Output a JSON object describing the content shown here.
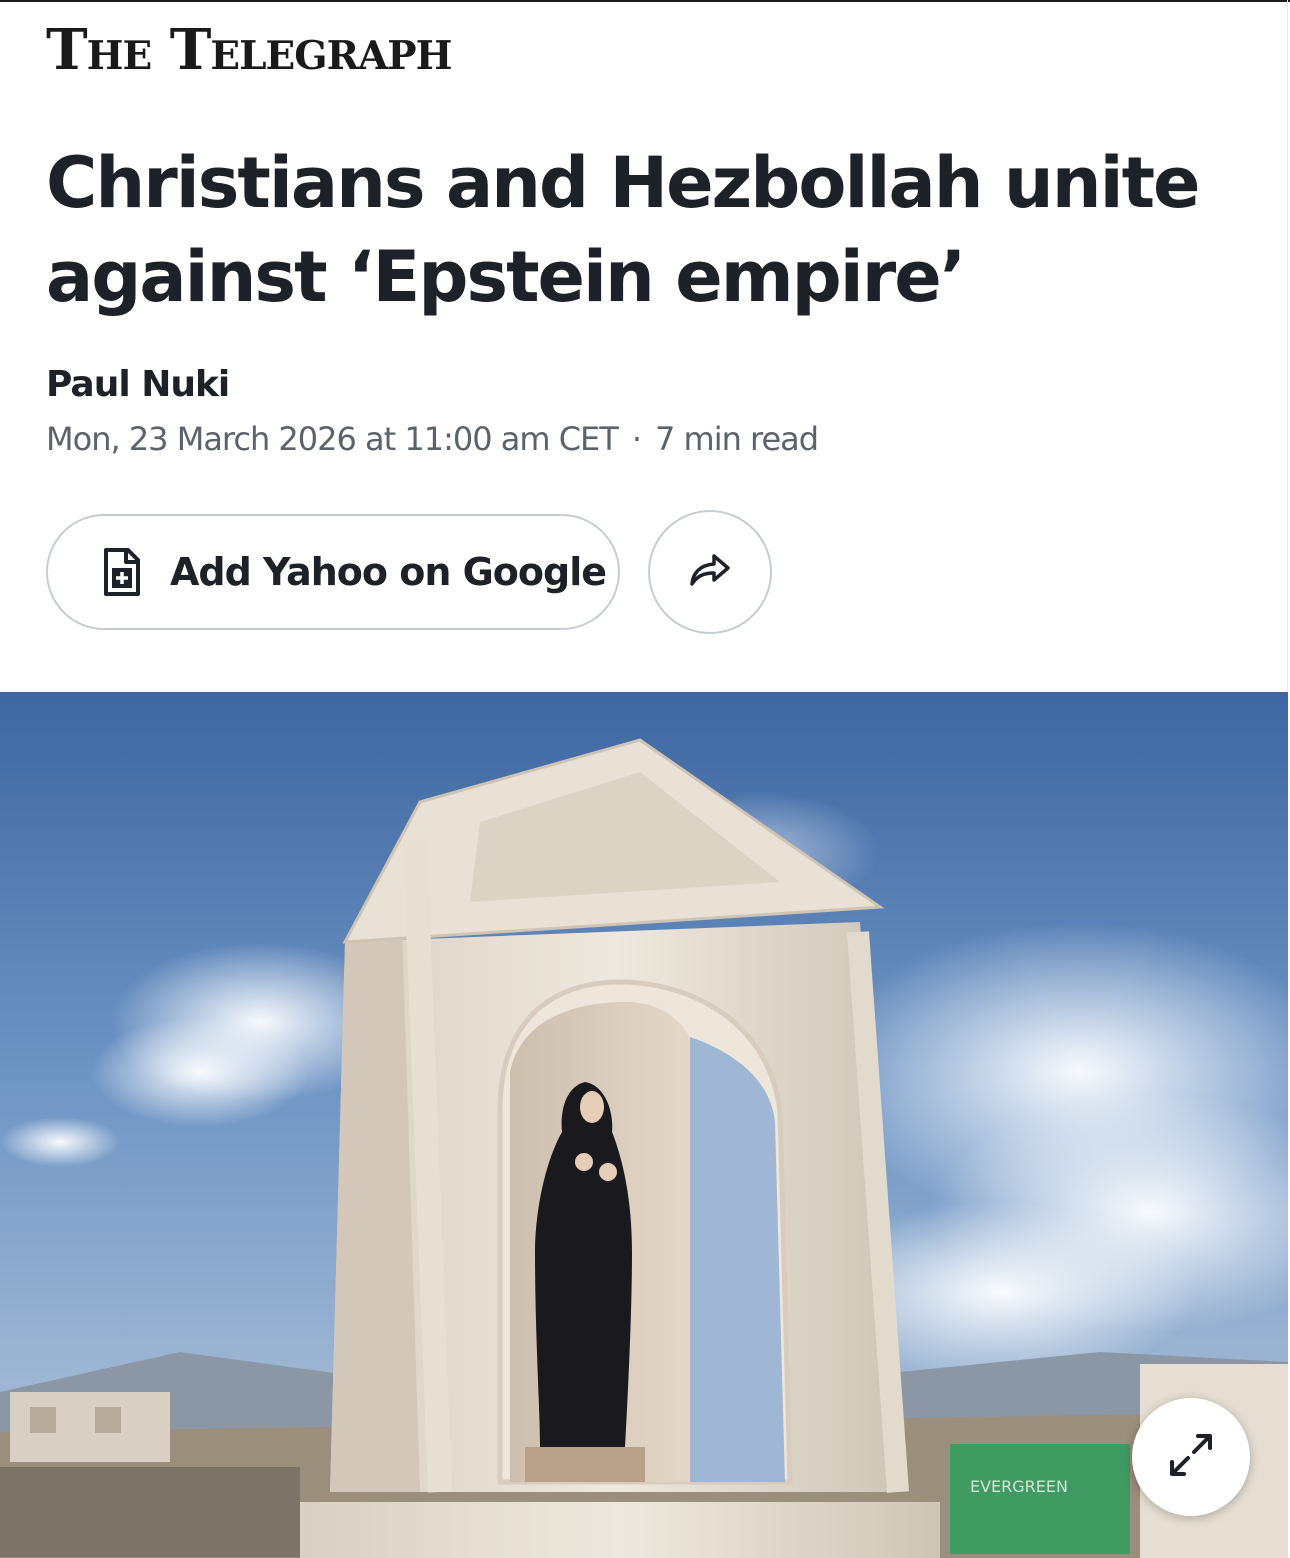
{
  "publisher": {
    "name": "The Telegraph"
  },
  "article": {
    "headline": "Christians and Hezbollah unite against ‘Epstein empire’",
    "author": "Paul Nuki",
    "date": "Mon, 23 March 2026 at 11:00 am CET",
    "separator": "·",
    "read_time": "7 min read"
  },
  "actions": {
    "add_google_label": "Add Yahoo on Google",
    "add_google_icon": "document-plus-icon",
    "share_icon": "share-arrow-icon"
  },
  "hero_image": {
    "expand_icon": "expand-arrows-icon",
    "container_text": "EVERGREEN"
  },
  "colors": {
    "text_primary": "#1d2228",
    "text_secondary": "#5b636a",
    "button_border": "#c8ccd0"
  }
}
